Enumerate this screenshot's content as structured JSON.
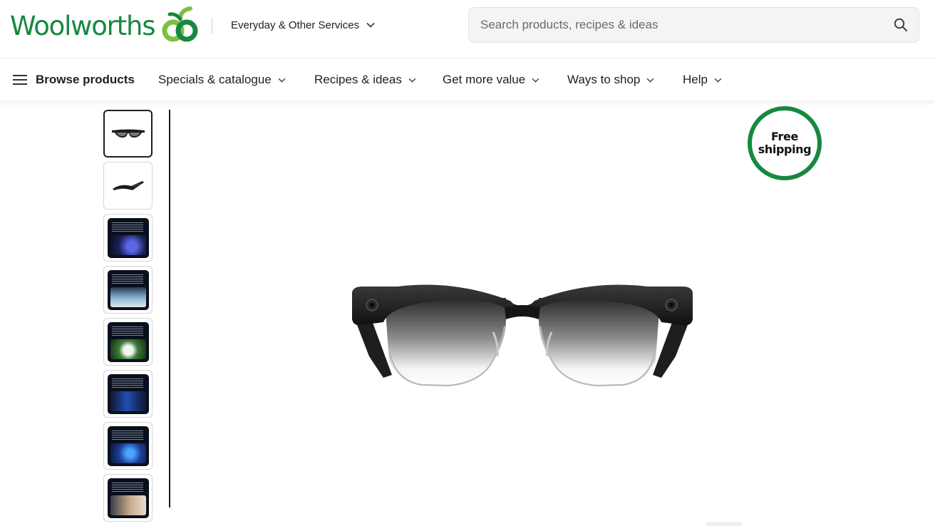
{
  "brand": {
    "name": "Woolworths",
    "color": "#178841"
  },
  "header": {
    "services_label": "Everyday & Other Services",
    "services_icon": "chevron-down-icon",
    "search_placeholder": "Search products, recipes & ideas",
    "search_value": "",
    "search_icon": "search-icon"
  },
  "nav": {
    "browse_label": "Browse products",
    "browse_icon": "hamburger-menu-icon",
    "items": [
      {
        "label": "Specials & catalogue"
      },
      {
        "label": "Recipes & ideas"
      },
      {
        "label": "Get more value"
      },
      {
        "label": "Ways to shop"
      },
      {
        "label": "Help"
      }
    ]
  },
  "gallery": {
    "thumbnails": [
      {
        "kind": "glasses-front",
        "selected": true
      },
      {
        "kind": "glasses-side",
        "selected": false
      },
      {
        "kind": "feature-image",
        "accent": "#3b49c2",
        "selected": false
      },
      {
        "kind": "feature-image",
        "accent": "#7fb2d6",
        "selected": false
      },
      {
        "kind": "feature-image",
        "accent": "#2e6b2f",
        "selected": false
      },
      {
        "kind": "feature-image",
        "accent": "#1f4fb3",
        "selected": false
      },
      {
        "kind": "feature-image",
        "accent": "#2a6fd1",
        "selected": false
      },
      {
        "kind": "feature-image",
        "accent": "#c9a98a",
        "selected": false
      }
    ],
    "main_image": "smart-glasses-front-view"
  },
  "badge": {
    "line1": "Free",
    "line2": "shipping",
    "color": "#178841"
  }
}
